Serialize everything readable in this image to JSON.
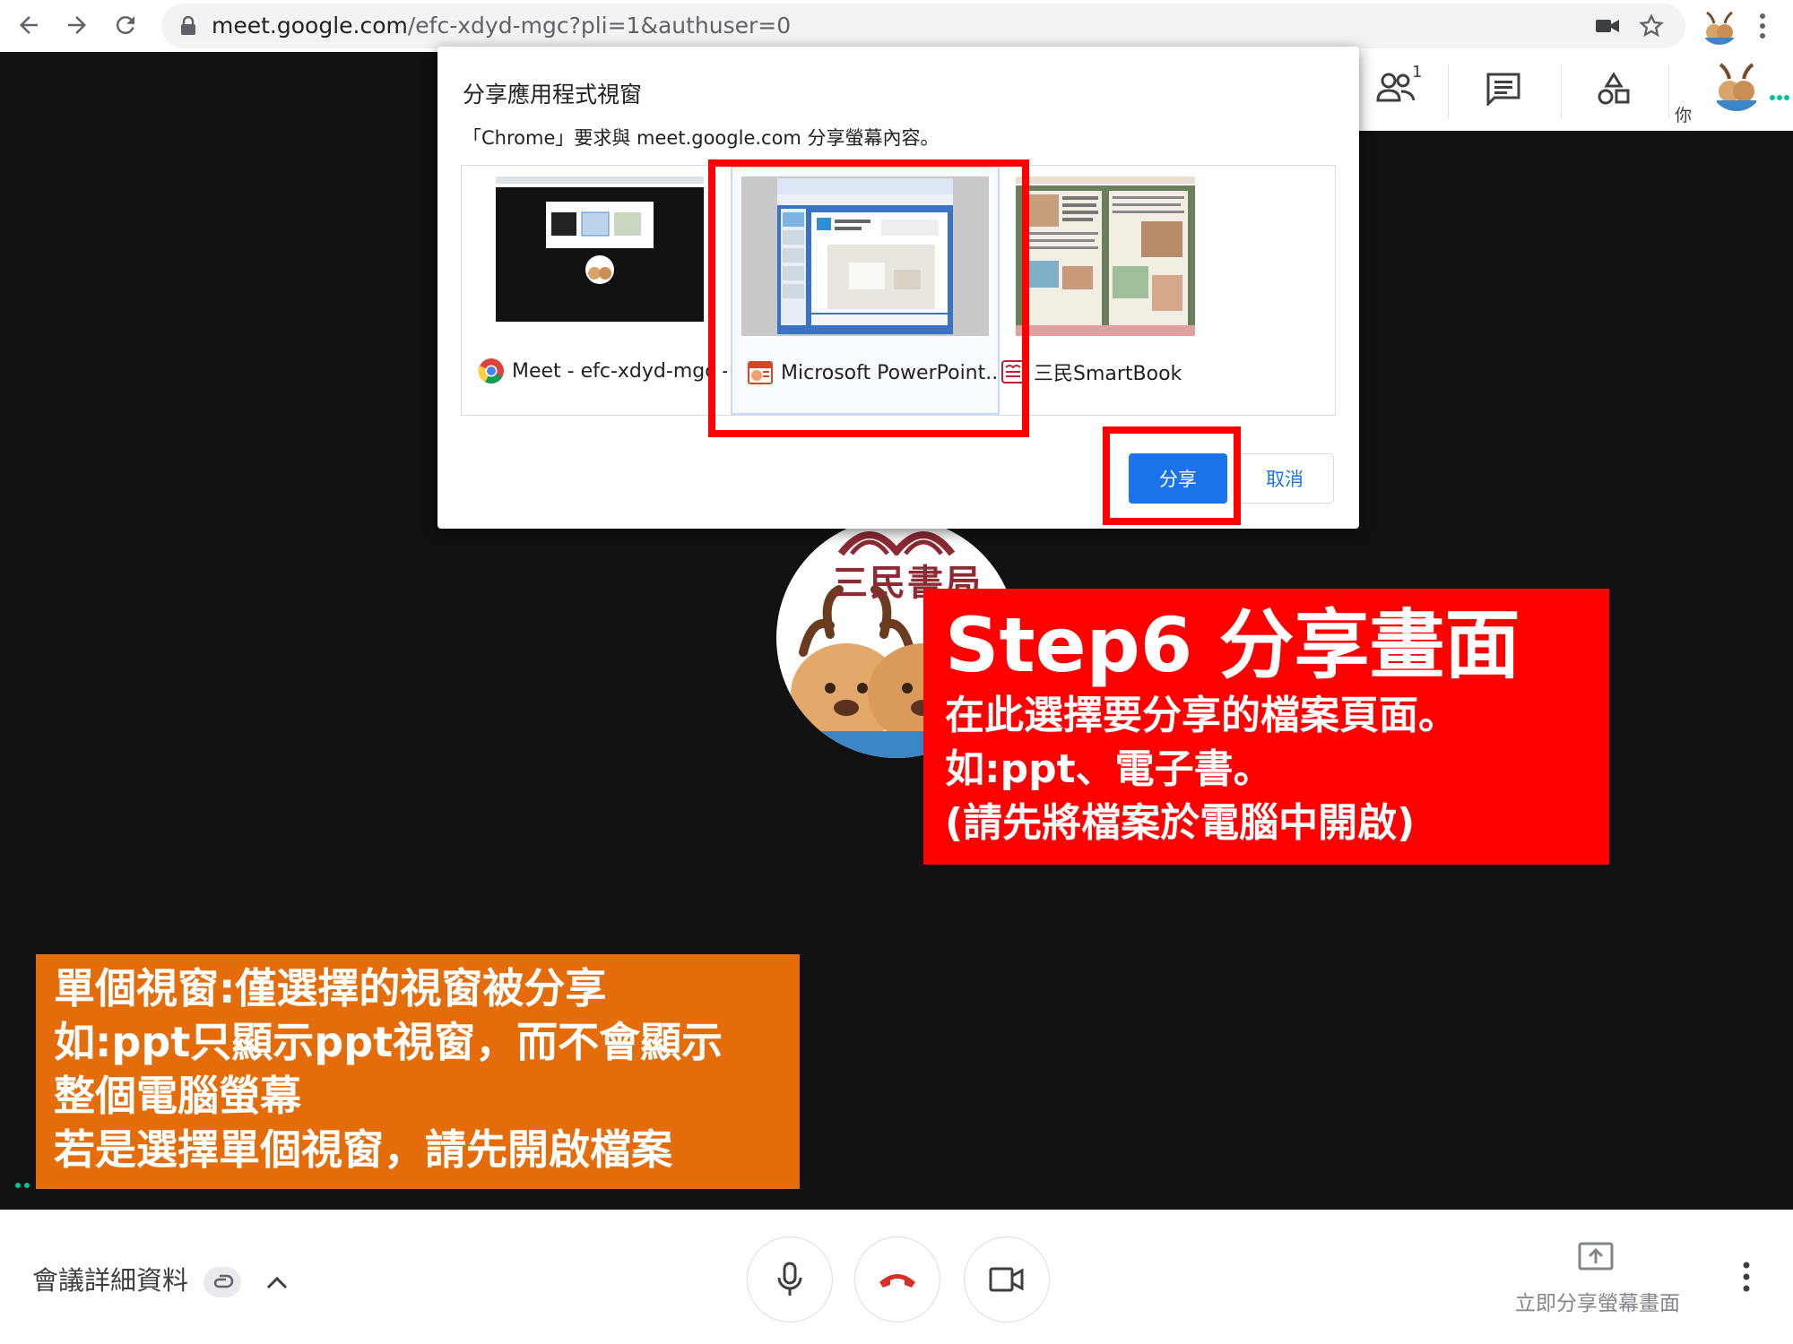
{
  "browser": {
    "url_host": "meet.google.com",
    "url_path": "/efc-xdyd-mgc?pli=1&authuser=0"
  },
  "meet_toolbar": {
    "participants_count": "1",
    "you_label": "你"
  },
  "avatar": {
    "logo_text": "三民書局"
  },
  "share_dialog": {
    "title": "分享應用程式視窗",
    "subtitle": "「Chrome」要求與 meet.google.com 分享螢幕內容。",
    "windows": [
      {
        "label": "Meet - efc-xdyd-mgc -",
        "icon": "chrome-icon",
        "selected": false
      },
      {
        "label": "Microsoft PowerPoint...",
        "icon": "powerpoint-icon",
        "selected": true
      },
      {
        "label": "三民SmartBook",
        "icon": "smartbook-icon",
        "selected": false
      }
    ],
    "share_label": "分享",
    "cancel_label": "取消"
  },
  "step_callout": {
    "title": "Step6 分享畫面",
    "lines": [
      "在此選擇要分享的檔案頁面。",
      "如:ppt、電子書。",
      "(請先將檔案於電腦中開啟)"
    ]
  },
  "orange_callout": {
    "lines": [
      "單個視窗:僅選擇的視窗被分享",
      "如:ppt只顯示ppt視窗，而不會顯示",
      "整個電腦螢幕",
      "若是選擇單個視窗，請先開啟檔案"
    ]
  },
  "bottom_bar": {
    "meeting_details": "會議詳細資料",
    "present_label": "立即分享螢幕畫面"
  },
  "colors": {
    "highlight": "#ff0000",
    "orange": "#e46c0a",
    "primary": "#1a73e8",
    "hangup": "#d93025"
  }
}
